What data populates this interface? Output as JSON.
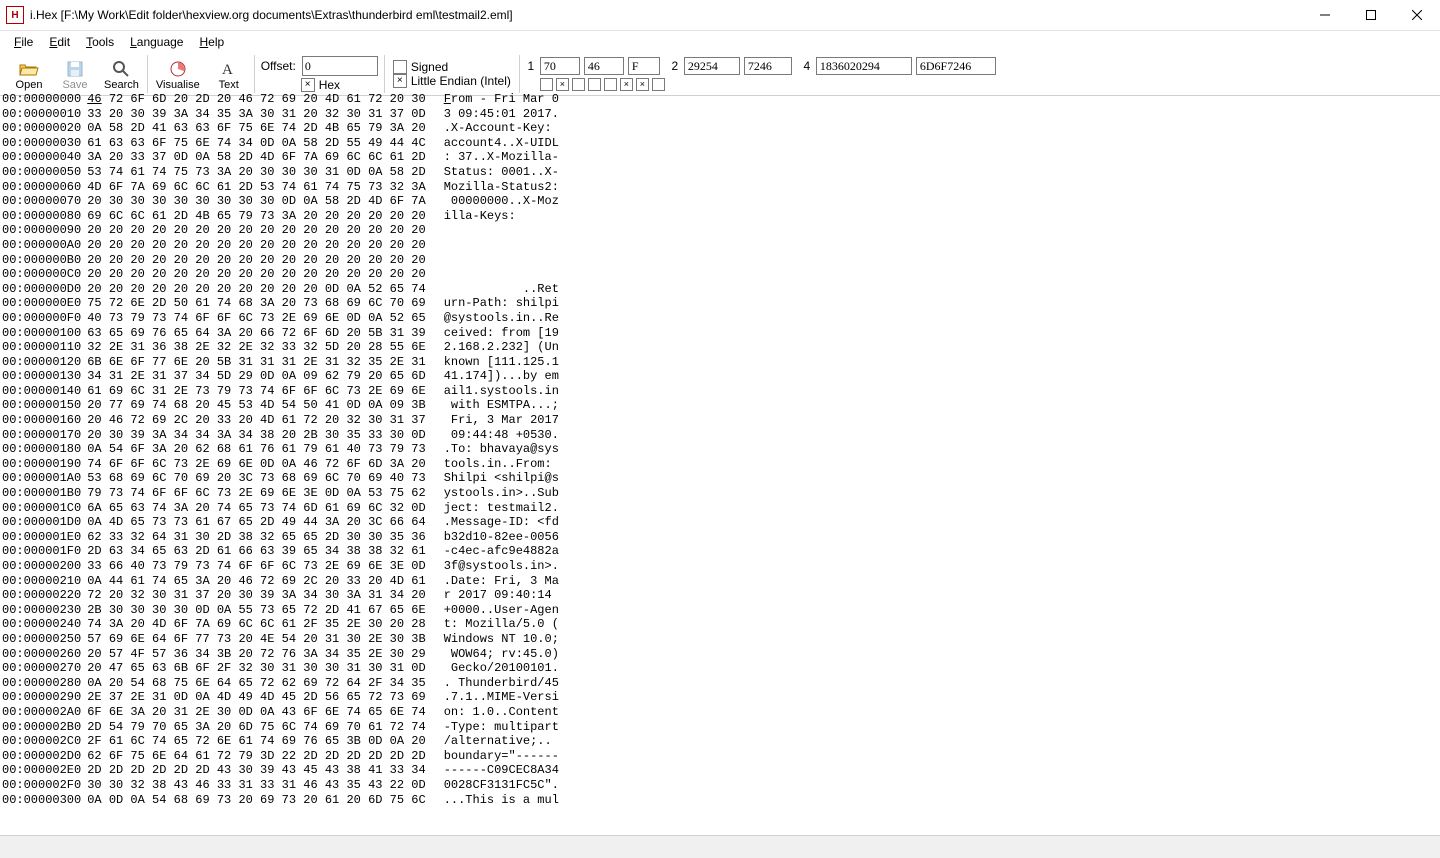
{
  "window": {
    "title": "i.Hex [F:\\My Work\\Edit folder\\hexview.org documents\\Extras\\thunderbird eml\\testmail2.eml]"
  },
  "menu": {
    "file": "File",
    "edit": "Edit",
    "tools": "Tools",
    "language": "Language",
    "help": "Help"
  },
  "toolbar": {
    "open": "Open",
    "save": "Save",
    "search": "Search",
    "visualise": "Visualise",
    "text": "Text",
    "offset_label": "Offset:",
    "offset_value": "0",
    "hex_label": "Hex",
    "hex_checked": true,
    "signed_label": "Signed",
    "signed_checked": false,
    "endian_label": "Little Endian (Intel)",
    "endian_checked": true
  },
  "values": {
    "row1": {
      "n": "1",
      "b1": "70",
      "b2": "46",
      "b3": "F"
    },
    "row2": {
      "n": "2",
      "b1": "29254",
      "b2": "7246"
    },
    "row3": {
      "n": "4",
      "b1": "1836020294",
      "b2": "6D6F7246"
    },
    "dots": [
      false,
      true,
      false,
      false,
      false,
      true,
      true,
      false
    ]
  },
  "hex": {
    "rows": [
      {
        "addr": "00:00000000",
        "bytes": "46 72 6F 6D 20 2D 20 46 72 69 20 4D 61 72 20 30",
        "ascii": "From - Fri Mar 0",
        "cursor": true
      },
      {
        "addr": "00:00000010",
        "bytes": "33 20 30 39 3A 34 35 3A 30 31 20 32 30 31 37 0D",
        "ascii": "3 09:45:01 2017."
      },
      {
        "addr": "00:00000020",
        "bytes": "0A 58 2D 41 63 63 6F 75 6E 74 2D 4B 65 79 3A 20",
        "ascii": ".X-Account-Key: "
      },
      {
        "addr": "00:00000030",
        "bytes": "61 63 63 6F 75 6E 74 34 0D 0A 58 2D 55 49 44 4C",
        "ascii": "account4..X-UIDL"
      },
      {
        "addr": "00:00000040",
        "bytes": "3A 20 33 37 0D 0A 58 2D 4D 6F 7A 69 6C 6C 61 2D",
        "ascii": ": 37..X-Mozilla-"
      },
      {
        "addr": "00:00000050",
        "bytes": "53 74 61 74 75 73 3A 20 30 30 30 31 0D 0A 58 2D",
        "ascii": "Status: 0001..X-"
      },
      {
        "addr": "00:00000060",
        "bytes": "4D 6F 7A 69 6C 6C 61 2D 53 74 61 74 75 73 32 3A",
        "ascii": "Mozilla-Status2:"
      },
      {
        "addr": "00:00000070",
        "bytes": "20 30 30 30 30 30 30 30 30 0D 0A 58 2D 4D 6F 7A",
        "ascii": " 00000000..X-Moz"
      },
      {
        "addr": "00:00000080",
        "bytes": "69 6C 6C 61 2D 4B 65 79 73 3A 20 20 20 20 20 20",
        "ascii": "illa-Keys:      "
      },
      {
        "addr": "00:00000090",
        "bytes": "20 20 20 20 20 20 20 20 20 20 20 20 20 20 20 20",
        "ascii": "                "
      },
      {
        "addr": "00:000000A0",
        "bytes": "20 20 20 20 20 20 20 20 20 20 20 20 20 20 20 20",
        "ascii": "                "
      },
      {
        "addr": "00:000000B0",
        "bytes": "20 20 20 20 20 20 20 20 20 20 20 20 20 20 20 20",
        "ascii": "                "
      },
      {
        "addr": "00:000000C0",
        "bytes": "20 20 20 20 20 20 20 20 20 20 20 20 20 20 20 20",
        "ascii": "                "
      },
      {
        "addr": "00:000000D0",
        "bytes": "20 20 20 20 20 20 20 20 20 20 20 0D 0A 52 65 74",
        "ascii": "           ..Ret"
      },
      {
        "addr": "00:000000E0",
        "bytes": "75 72 6E 2D 50 61 74 68 3A 20 73 68 69 6C 70 69",
        "ascii": "urn-Path: shilpi"
      },
      {
        "addr": "00:000000F0",
        "bytes": "40 73 79 73 74 6F 6F 6C 73 2E 69 6E 0D 0A 52 65",
        "ascii": "@systools.in..Re"
      },
      {
        "addr": "00:00000100",
        "bytes": "63 65 69 76 65 64 3A 20 66 72 6F 6D 20 5B 31 39",
        "ascii": "ceived: from [19"
      },
      {
        "addr": "00:00000110",
        "bytes": "32 2E 31 36 38 2E 32 2E 32 33 32 5D 20 28 55 6E",
        "ascii": "2.168.2.232] (Un"
      },
      {
        "addr": "00:00000120",
        "bytes": "6B 6E 6F 77 6E 20 5B 31 31 31 2E 31 32 35 2E 31",
        "ascii": "known [111.125.1"
      },
      {
        "addr": "00:00000130",
        "bytes": "34 31 2E 31 37 34 5D 29 0D 0A 09 62 79 20 65 6D",
        "ascii": "41.174])...by em"
      },
      {
        "addr": "00:00000140",
        "bytes": "61 69 6C 31 2E 73 79 73 74 6F 6F 6C 73 2E 69 6E",
        "ascii": "ail1.systools.in"
      },
      {
        "addr": "00:00000150",
        "bytes": "20 77 69 74 68 20 45 53 4D 54 50 41 0D 0A 09 3B",
        "ascii": " with ESMTPA...;"
      },
      {
        "addr": "00:00000160",
        "bytes": "20 46 72 69 2C 20 33 20 4D 61 72 20 32 30 31 37",
        "ascii": " Fri, 3 Mar 2017"
      },
      {
        "addr": "00:00000170",
        "bytes": "20 30 39 3A 34 34 3A 34 38 20 2B 30 35 33 30 0D",
        "ascii": " 09:44:48 +0530."
      },
      {
        "addr": "00:00000180",
        "bytes": "0A 54 6F 3A 20 62 68 61 76 61 79 61 40 73 79 73",
        "ascii": ".To: bhavaya@sys"
      },
      {
        "addr": "00:00000190",
        "bytes": "74 6F 6F 6C 73 2E 69 6E 0D 0A 46 72 6F 6D 3A 20",
        "ascii": "tools.in..From: "
      },
      {
        "addr": "00:000001A0",
        "bytes": "53 68 69 6C 70 69 20 3C 73 68 69 6C 70 69 40 73",
        "ascii": "Shilpi <shilpi@s"
      },
      {
        "addr": "00:000001B0",
        "bytes": "79 73 74 6F 6F 6C 73 2E 69 6E 3E 0D 0A 53 75 62",
        "ascii": "ystools.in>..Sub"
      },
      {
        "addr": "00:000001C0",
        "bytes": "6A 65 63 74 3A 20 74 65 73 74 6D 61 69 6C 32 0D",
        "ascii": "ject: testmail2."
      },
      {
        "addr": "00:000001D0",
        "bytes": "0A 4D 65 73 73 61 67 65 2D 49 44 3A 20 3C 66 64",
        "ascii": ".Message-ID: <fd"
      },
      {
        "addr": "00:000001E0",
        "bytes": "62 33 32 64 31 30 2D 38 32 65 65 2D 30 30 35 36",
        "ascii": "b32d10-82ee-0056"
      },
      {
        "addr": "00:000001F0",
        "bytes": "2D 63 34 65 63 2D 61 66 63 39 65 34 38 38 32 61",
        "ascii": "-c4ec-afc9e4882a"
      },
      {
        "addr": "00:00000200",
        "bytes": "33 66 40 73 79 73 74 6F 6F 6C 73 2E 69 6E 3E 0D",
        "ascii": "3f@systools.in>."
      },
      {
        "addr": "00:00000210",
        "bytes": "0A 44 61 74 65 3A 20 46 72 69 2C 20 33 20 4D 61",
        "ascii": ".Date: Fri, 3 Ma"
      },
      {
        "addr": "00:00000220",
        "bytes": "72 20 32 30 31 37 20 30 39 3A 34 30 3A 31 34 20",
        "ascii": "r 2017 09:40:14 "
      },
      {
        "addr": "00:00000230",
        "bytes": "2B 30 30 30 30 0D 0A 55 73 65 72 2D 41 67 65 6E",
        "ascii": "+0000..User-Agen"
      },
      {
        "addr": "00:00000240",
        "bytes": "74 3A 20 4D 6F 7A 69 6C 6C 61 2F 35 2E 30 20 28",
        "ascii": "t: Mozilla/5.0 ("
      },
      {
        "addr": "00:00000250",
        "bytes": "57 69 6E 64 6F 77 73 20 4E 54 20 31 30 2E 30 3B",
        "ascii": "Windows NT 10.0;"
      },
      {
        "addr": "00:00000260",
        "bytes": "20 57 4F 57 36 34 3B 20 72 76 3A 34 35 2E 30 29",
        "ascii": " WOW64; rv:45.0)"
      },
      {
        "addr": "00:00000270",
        "bytes": "20 47 65 63 6B 6F 2F 32 30 31 30 30 31 30 31 0D",
        "ascii": " Gecko/20100101."
      },
      {
        "addr": "00:00000280",
        "bytes": "0A 20 54 68 75 6E 64 65 72 62 69 72 64 2F 34 35",
        "ascii": ". Thunderbird/45"
      },
      {
        "addr": "00:00000290",
        "bytes": "2E 37 2E 31 0D 0A 4D 49 4D 45 2D 56 65 72 73 69",
        "ascii": ".7.1..MIME-Versi"
      },
      {
        "addr": "00:000002A0",
        "bytes": "6F 6E 3A 20 31 2E 30 0D 0A 43 6F 6E 74 65 6E 74",
        "ascii": "on: 1.0..Content"
      },
      {
        "addr": "00:000002B0",
        "bytes": "2D 54 79 70 65 3A 20 6D 75 6C 74 69 70 61 72 74",
        "ascii": "-Type: multipart"
      },
      {
        "addr": "00:000002C0",
        "bytes": "2F 61 6C 74 65 72 6E 61 74 69 76 65 3B 0D 0A 20",
        "ascii": "/alternative;.. "
      },
      {
        "addr": "00:000002D0",
        "bytes": "62 6F 75 6E 64 61 72 79 3D 22 2D 2D 2D 2D 2D 2D",
        "ascii": "boundary=\"------"
      },
      {
        "addr": "00:000002E0",
        "bytes": "2D 2D 2D 2D 2D 2D 43 30 39 43 45 43 38 41 33 34",
        "ascii": "------C09CEC8A34"
      },
      {
        "addr": "00:000002F0",
        "bytes": "30 30 32 38 43 46 33 31 33 31 46 43 35 43 22 0D",
        "ascii": "0028CF3131FC5C\"."
      },
      {
        "addr": "00:00000300",
        "bytes": "0A 0D 0A 54 68 69 73 20 69 73 20 61 20 6D 75 6C",
        "ascii": "...This is a mul"
      }
    ]
  }
}
